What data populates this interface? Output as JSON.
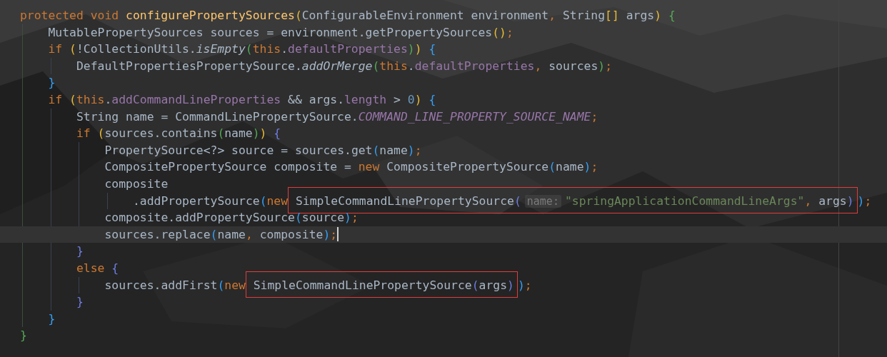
{
  "editor": {
    "lines": [
      {
        "tokens": [
          {
            "text": "protected ",
            "kind": "keyword"
          },
          {
            "text": "void ",
            "kind": "keyword"
          },
          {
            "text": "configurePropertySources",
            "kind": "declaration"
          },
          {
            "text": "(",
            "kind": "bracket",
            "color": "#e8ba36"
          },
          {
            "text": "ConfigurableEnvironment environment",
            "kind": "plain"
          },
          {
            "text": ", ",
            "kind": "punct"
          },
          {
            "text": "String",
            "kind": "plain"
          },
          {
            "text": "[]",
            "kind": "bracket",
            "color": "#e8ba36"
          },
          {
            "text": " args",
            "kind": "plain"
          },
          {
            "text": ") ",
            "kind": "bracket",
            "color": "#e8ba36"
          },
          {
            "text": "{",
            "kind": "bracket",
            "color": "#54a857"
          }
        ],
        "current": false,
        "children": [
          {
            "tokens": [
              {
                "text": "MutablePropertySources sources = environment.getPropertySources",
                "kind": "plain"
              },
              {
                "text": "()",
                "kind": "bracket",
                "color": "#e8ba36"
              },
              {
                "text": ";",
                "kind": "punct"
              }
            ],
            "current": false
          },
          {
            "tokens": [
              {
                "text": "if ",
                "kind": "keyword"
              },
              {
                "text": "(",
                "kind": "bracket",
                "color": "#e8ba36"
              },
              {
                "text": "!CollectionUtils.",
                "kind": "plain"
              },
              {
                "text": "isEmpty",
                "kind": "method"
              },
              {
                "text": "(",
                "kind": "bracket",
                "color": "#54a857"
              },
              {
                "text": "this",
                "kind": "keyword"
              },
              {
                "text": ".",
                "kind": "plain"
              },
              {
                "text": "defaultProperties",
                "kind": "field"
              },
              {
                "text": ")",
                "kind": "bracket",
                "color": "#54a857"
              },
              {
                "text": ") ",
                "kind": "bracket",
                "color": "#e8ba36"
              },
              {
                "text": "{",
                "kind": "bracket",
                "color": "#359ff4"
              }
            ],
            "current": false,
            "children": [
              {
                "tokens": [
                  {
                    "text": "DefaultPropertiesPropertySource.",
                    "kind": "plain"
                  },
                  {
                    "text": "addOrMerge",
                    "kind": "method"
                  },
                  {
                    "text": "(",
                    "kind": "bracket",
                    "color": "#54a857"
                  },
                  {
                    "text": "this",
                    "kind": "keyword"
                  },
                  {
                    "text": ".",
                    "kind": "plain"
                  },
                  {
                    "text": "defaultProperties",
                    "kind": "field"
                  },
                  {
                    "text": ", ",
                    "kind": "punct"
                  },
                  {
                    "text": "sources",
                    "kind": "plain"
                  },
                  {
                    "text": ")",
                    "kind": "bracket",
                    "color": "#54a857"
                  },
                  {
                    "text": ";",
                    "kind": "punct"
                  }
                ],
                "current": false
              }
            ]
          },
          {
            "tokens": [
              {
                "text": "}",
                "kind": "bracket",
                "color": "#359ff4"
              }
            ],
            "current": false
          },
          {
            "tokens": [
              {
                "text": "if ",
                "kind": "keyword"
              },
              {
                "text": "(",
                "kind": "bracket",
                "color": "#e8ba36"
              },
              {
                "text": "this",
                "kind": "keyword"
              },
              {
                "text": ".",
                "kind": "plain"
              },
              {
                "text": "addCommandLineProperties",
                "kind": "field"
              },
              {
                "text": " && args.",
                "kind": "plain"
              },
              {
                "text": "length",
                "kind": "field"
              },
              {
                "text": " > ",
                "kind": "plain"
              },
              {
                "text": "0",
                "kind": "number"
              },
              {
                "text": ") ",
                "kind": "bracket",
                "color": "#e8ba36"
              },
              {
                "text": "{",
                "kind": "bracket",
                "color": "#359ff4"
              }
            ],
            "current": false,
            "children": [
              {
                "tokens": [
                  {
                    "text": "String name = CommandLinePropertySource.",
                    "kind": "plain"
                  },
                  {
                    "text": "COMMAND_LINE_PROPERTY_SOURCE_NAME",
                    "kind": "constant"
                  },
                  {
                    "text": ";",
                    "kind": "punct"
                  }
                ],
                "current": false
              },
              {
                "tokens": [
                  {
                    "text": "if ",
                    "kind": "keyword"
                  },
                  {
                    "text": "(",
                    "kind": "bracket",
                    "color": "#e8ba36"
                  },
                  {
                    "text": "sources.contains",
                    "kind": "plain"
                  },
                  {
                    "text": "(",
                    "kind": "bracket",
                    "color": "#54a857"
                  },
                  {
                    "text": "name",
                    "kind": "plain"
                  },
                  {
                    "text": ")",
                    "kind": "bracket",
                    "color": "#54a857"
                  },
                  {
                    "text": ") ",
                    "kind": "bracket",
                    "color": "#e8ba36"
                  },
                  {
                    "text": "{",
                    "kind": "bracket",
                    "color": "#6d7ce0"
                  }
                ],
                "current": false,
                "children": [
                  {
                    "tokens": [
                      {
                        "text": "PropertySource<?> source = sources.get",
                        "kind": "plain"
                      },
                      {
                        "text": "(",
                        "kind": "bracket",
                        "color": "#359ff4"
                      },
                      {
                        "text": "name",
                        "kind": "plain"
                      },
                      {
                        "text": ")",
                        "kind": "bracket",
                        "color": "#359ff4"
                      },
                      {
                        "text": ";",
                        "kind": "punct"
                      }
                    ],
                    "current": false
                  },
                  {
                    "tokens": [
                      {
                        "text": "CompositePropertySource composite = ",
                        "kind": "plain"
                      },
                      {
                        "text": "new ",
                        "kind": "keyword"
                      },
                      {
                        "text": "CompositePropertySource",
                        "kind": "plain"
                      },
                      {
                        "text": "(",
                        "kind": "bracket",
                        "color": "#359ff4"
                      },
                      {
                        "text": "name",
                        "kind": "plain"
                      },
                      {
                        "text": ")",
                        "kind": "bracket",
                        "color": "#359ff4"
                      },
                      {
                        "text": ";",
                        "kind": "punct"
                      }
                    ],
                    "current": false
                  },
                  {
                    "tokens": [
                      {
                        "text": "composite",
                        "kind": "plain"
                      }
                    ],
                    "current": false,
                    "children": [
                      {
                        "tokens": [
                          {
                            "text": ".addPropertySource",
                            "kind": "plain"
                          },
                          {
                            "text": "(",
                            "kind": "bracket",
                            "color": "#359ff4"
                          },
                          {
                            "text": "new",
                            "kind": "keyword"
                          },
                          {
                            "kind": "highlight",
                            "tokens": [
                              {
                                "text": " SimpleCommandLinePropertySource",
                                "kind": "plain"
                              },
                              {
                                "text": "(",
                                "kind": "bracket",
                                "color": "#6d7ce0"
                              },
                              {
                                "text": "name:",
                                "kind": "hint"
                              },
                              {
                                "text": "\"springApplicationCommandLineArgs\"",
                                "kind": "string"
                              },
                              {
                                "text": ", ",
                                "kind": "punct"
                              },
                              {
                                "text": "args",
                                "kind": "plain"
                              },
                              {
                                "text": ")",
                                "kind": "bracket",
                                "color": "#6d7ce0"
                              }
                            ]
                          },
                          {
                            "text": ")",
                            "kind": "bracket",
                            "color": "#359ff4"
                          },
                          {
                            "text": ";",
                            "kind": "punct"
                          }
                        ],
                        "current": false
                      }
                    ]
                  },
                  {
                    "tokens": [
                      {
                        "text": "composite.addPropertySource",
                        "kind": "plain"
                      },
                      {
                        "text": "(",
                        "kind": "bracket",
                        "color": "#359ff4"
                      },
                      {
                        "text": "source",
                        "kind": "plain"
                      },
                      {
                        "text": ")",
                        "kind": "bracket",
                        "color": "#359ff4"
                      },
                      {
                        "text": ";",
                        "kind": "punct"
                      }
                    ],
                    "current": false
                  },
                  {
                    "tokens": [
                      {
                        "text": "sources.replace",
                        "kind": "plain"
                      },
                      {
                        "text": "(",
                        "kind": "bracket",
                        "color": "#359ff4"
                      },
                      {
                        "text": "name",
                        "kind": "plain"
                      },
                      {
                        "text": ", ",
                        "kind": "punct"
                      },
                      {
                        "text": "composite",
                        "kind": "plain"
                      },
                      {
                        "text": ")",
                        "kind": "bracket",
                        "color": "#359ff4"
                      },
                      {
                        "text": ";",
                        "kind": "punct"
                      }
                    ],
                    "current": true
                  }
                ]
              },
              {
                "tokens": [
                  {
                    "text": "}",
                    "kind": "bracket",
                    "color": "#6d7ce0"
                  }
                ],
                "current": false
              },
              {
                "tokens": [
                  {
                    "text": "else ",
                    "kind": "keyword"
                  },
                  {
                    "text": "{",
                    "kind": "bracket",
                    "color": "#6d7ce0"
                  }
                ],
                "current": false,
                "children": [
                  {
                    "tokens": [
                      {
                        "text": "sources.addFirst",
                        "kind": "plain"
                      },
                      {
                        "text": "(",
                        "kind": "bracket",
                        "color": "#359ff4"
                      },
                      {
                        "text": "new",
                        "kind": "keyword"
                      },
                      {
                        "kind": "highlight",
                        "tokens": [
                          {
                            "text": " SimpleCommandLinePropertySource",
                            "kind": "plain"
                          },
                          {
                            "text": "(",
                            "kind": "bracket",
                            "color": "#6d7ce0"
                          },
                          {
                            "text": "args",
                            "kind": "plain"
                          },
                          {
                            "text": ")",
                            "kind": "bracket",
                            "color": "#6d7ce0"
                          }
                        ]
                      },
                      {
                        "text": ")",
                        "kind": "bracket",
                        "color": "#359ff4"
                      },
                      {
                        "text": ";",
                        "kind": "punct"
                      }
                    ],
                    "current": false
                  }
                ]
              },
              {
                "tokens": [
                  {
                    "text": "}",
                    "kind": "bracket",
                    "color": "#6d7ce0"
                  }
                ],
                "current": false
              }
            ]
          },
          {
            "tokens": [
              {
                "text": "}",
                "kind": "bracket",
                "color": "#359ff4"
              }
            ],
            "current": false
          }
        ]
      },
      {
        "tokens": [
          {
            "text": "}",
            "kind": "bracket",
            "color": "#54a857"
          }
        ],
        "current": false
      }
    ]
  }
}
